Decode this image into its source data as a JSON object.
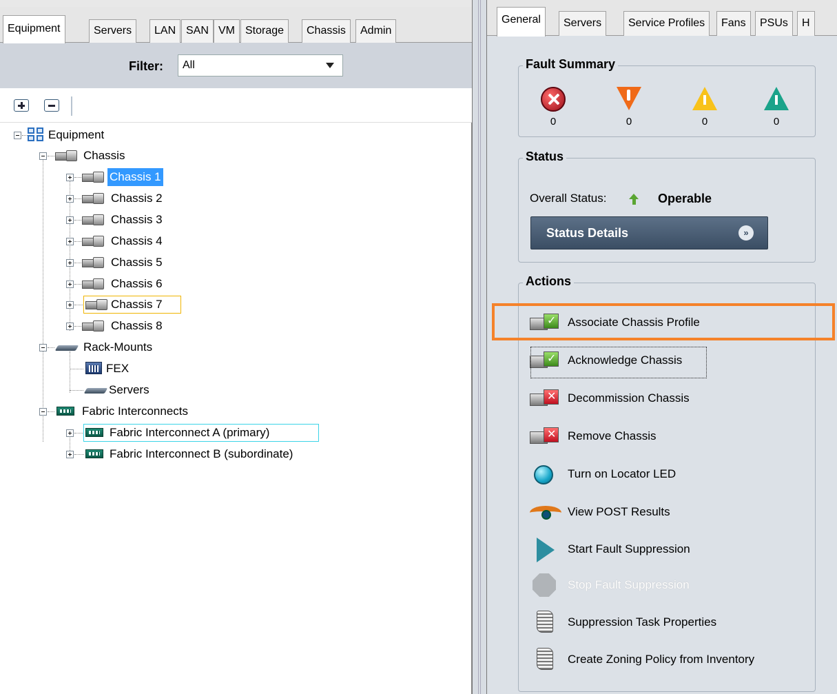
{
  "left_tabs": [
    "Equipment",
    "Servers",
    "LAN",
    "SAN",
    "VM",
    "Storage",
    "Chassis",
    "Admin"
  ],
  "filter": {
    "label": "Filter:",
    "value": "All"
  },
  "tree": {
    "root": "Equipment",
    "chassis_group": "Chassis",
    "chassis": [
      "Chassis 1",
      "Chassis 2",
      "Chassis 3",
      "Chassis 4",
      "Chassis 5",
      "Chassis 6",
      "Chassis 7",
      "Chassis 8"
    ],
    "rack_mounts": "Rack-Mounts",
    "fex": "FEX",
    "servers": "Servers",
    "fabric_interconnects": "Fabric Interconnects",
    "fi_a": "Fabric Interconnect A (primary)",
    "fi_b": "Fabric Interconnect B (subordinate)"
  },
  "right_tabs": [
    "General",
    "Servers",
    "Service Profiles",
    "Fans",
    "PSUs",
    "H"
  ],
  "fault_summary": {
    "title": "Fault Summary",
    "counts": [
      "0",
      "0",
      "0",
      "0"
    ]
  },
  "status": {
    "title": "Status",
    "overall_label": "Overall Status:",
    "overall_value": "Operable",
    "details_button": "Status Details"
  },
  "actions": {
    "title": "Actions",
    "items": [
      "Associate Chassis Profile",
      "Acknowledge Chassis",
      "Decommission Chassis",
      "Remove Chassis",
      "Turn on Locator LED",
      "View POST Results",
      "Start Fault Suppression",
      "Stop Fault Suppression",
      "Suppression Task Properties",
      "Create Zoning Policy from Inventory"
    ]
  },
  "colors": {
    "highlight": "#f5822a",
    "selected": "#3399ff",
    "status_details_bg": "#3b4e64"
  }
}
